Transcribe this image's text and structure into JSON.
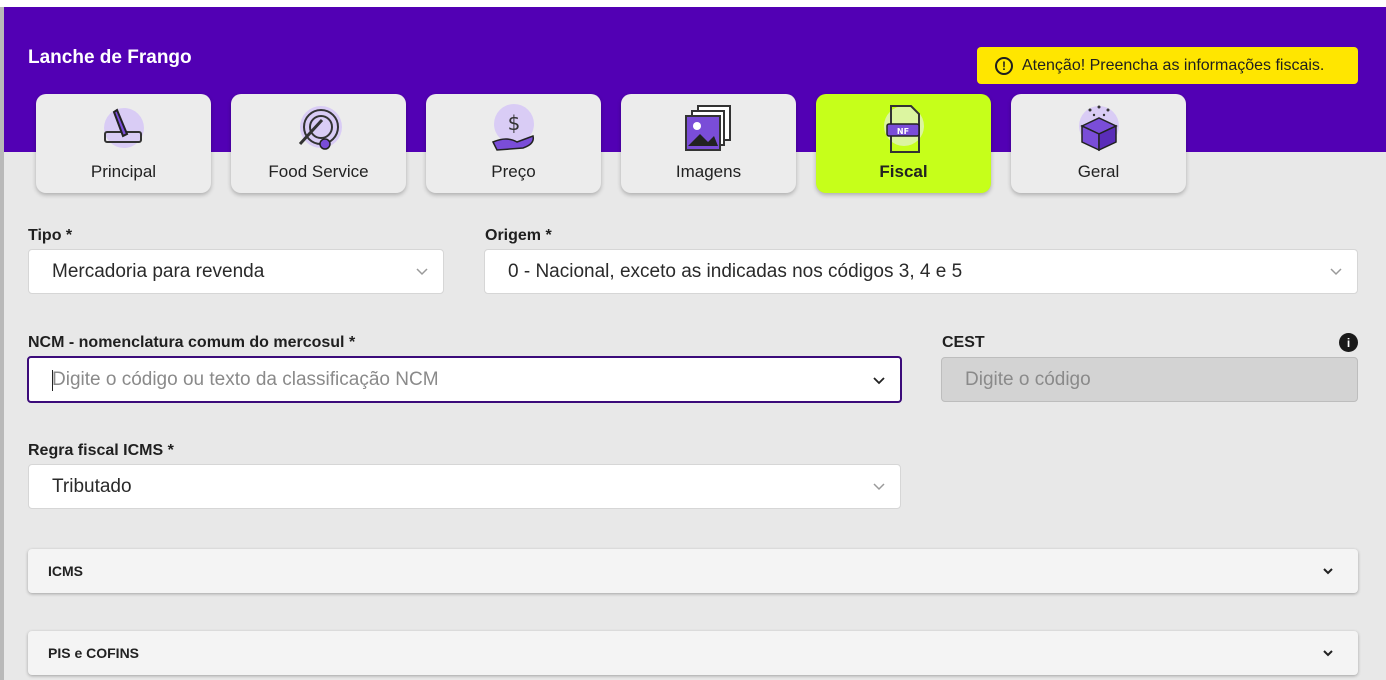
{
  "product": {
    "title": "Lanche de Frango"
  },
  "alert": {
    "icon": "exclamation-circle-icon",
    "text": "Atenção! Preencha as informações fiscais."
  },
  "tabs": [
    {
      "label": "Principal",
      "icon": "pencil-icon"
    },
    {
      "label": "Food Service",
      "icon": "plate-cutlery-icon"
    },
    {
      "label": "Preço",
      "icon": "dollar-hand-icon"
    },
    {
      "label": "Imagens",
      "icon": "images-icon"
    },
    {
      "label": "Fiscal",
      "icon": "nf-document-icon",
      "active": true
    },
    {
      "label": "Geral",
      "icon": "box-icon"
    }
  ],
  "form": {
    "tipo": {
      "label": "Tipo *",
      "value": "Mercadoria para revenda"
    },
    "origem": {
      "label": "Origem *",
      "value": "0 - Nacional, exceto as indicadas nos códigos 3, 4 e 5"
    },
    "ncm": {
      "label": "NCM - nomenclatura comum do mercosul *",
      "placeholder": "Digite o código ou texto da classificação NCM"
    },
    "cest": {
      "label": "CEST",
      "placeholder": "Digite o código",
      "info_icon": "info-icon"
    },
    "regra": {
      "label": "Regra fiscal ICMS *",
      "value": "Tributado"
    }
  },
  "accordions": [
    {
      "label": "ICMS"
    },
    {
      "label": "PIS e COFINS"
    }
  ],
  "colors": {
    "header": "#5200b4",
    "active_tab": "#c6ff1a",
    "alert": "#ffe600",
    "icon_purple": "#7a4dd8"
  }
}
